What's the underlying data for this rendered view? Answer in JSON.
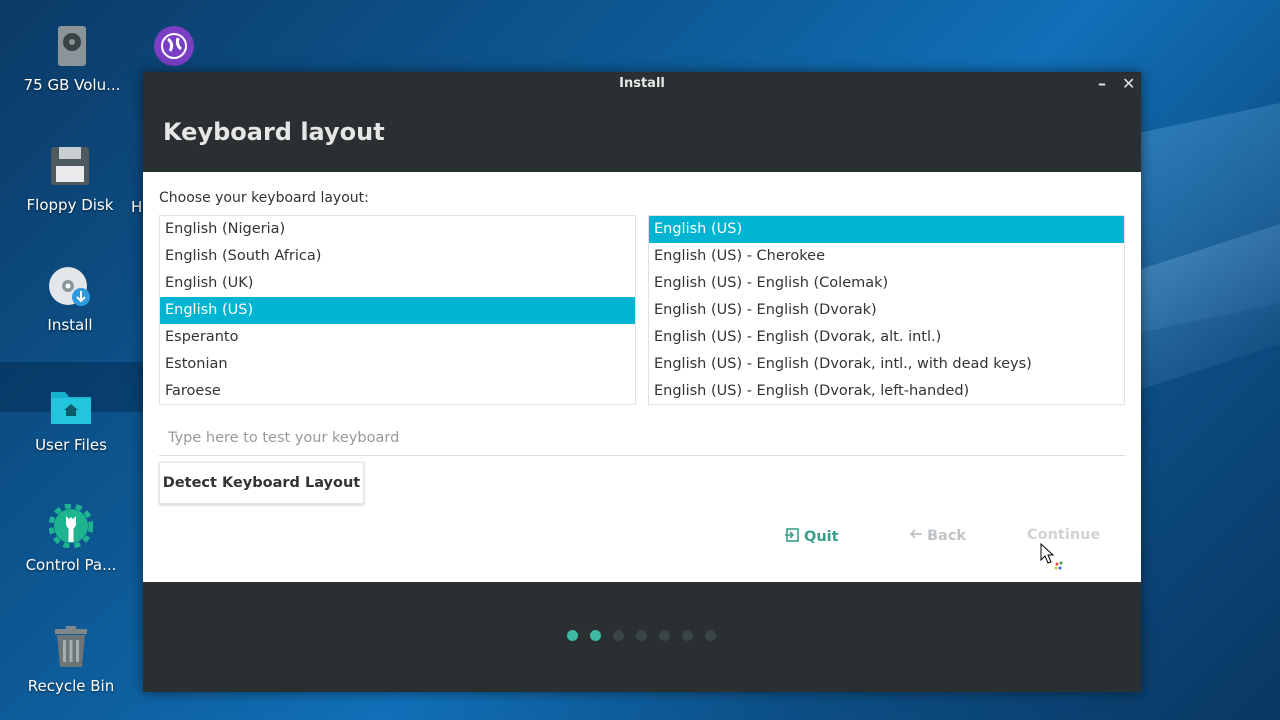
{
  "desktop": {
    "icons": [
      {
        "label": "75 GB Volu...",
        "icon": "drive-icon"
      },
      {
        "label": "Floppy Disk",
        "icon": "floppy-icon"
      },
      {
        "label": "Install",
        "icon": "install-disc-icon"
      },
      {
        "label": "User Files",
        "icon": "home-folder-icon"
      },
      {
        "label": "Control Pa...",
        "icon": "control-panel-icon"
      },
      {
        "label": "Recycle Bin",
        "icon": "recycle-bin-icon"
      }
    ],
    "partial_label": "H",
    "top_app_icon": "globe-icon"
  },
  "window": {
    "title": "Install",
    "minimize_glyph": "–",
    "close_glyph": "✕"
  },
  "page": {
    "heading": "Keyboard layout",
    "prompt": "Choose your keyboard layout:",
    "layouts": [
      {
        "label": "English (Nigeria)",
        "selected": false
      },
      {
        "label": "English (South Africa)",
        "selected": false
      },
      {
        "label": "English (UK)",
        "selected": false
      },
      {
        "label": "English (US)",
        "selected": true
      },
      {
        "label": "Esperanto",
        "selected": false
      },
      {
        "label": "Estonian",
        "selected": false
      },
      {
        "label": "Faroese",
        "selected": false
      }
    ],
    "variants": [
      {
        "label": "English (US)",
        "selected": true
      },
      {
        "label": "English (US) - Cherokee",
        "selected": false
      },
      {
        "label": "English (US) - English (Colemak)",
        "selected": false
      },
      {
        "label": "English (US) - English (Dvorak)",
        "selected": false
      },
      {
        "label": "English (US) - English (Dvorak, alt. intl.)",
        "selected": false
      },
      {
        "label": "English (US) - English (Dvorak, intl., with dead keys)",
        "selected": false
      },
      {
        "label": "English (US) - English (Dvorak, left-handed)",
        "selected": false
      }
    ],
    "test_placeholder": "Type here to test your keyboard",
    "test_value": "",
    "detect_label": "Detect Keyboard Layout",
    "quit_label": "Quit",
    "back_label": "Back",
    "continue_label": "Continue"
  },
  "progress": {
    "total_steps": 7,
    "completed_steps": 2
  },
  "colors": {
    "accent": "#00b4d2",
    "quit": "#3a9e8a",
    "progress_done": "#3db9a1"
  }
}
